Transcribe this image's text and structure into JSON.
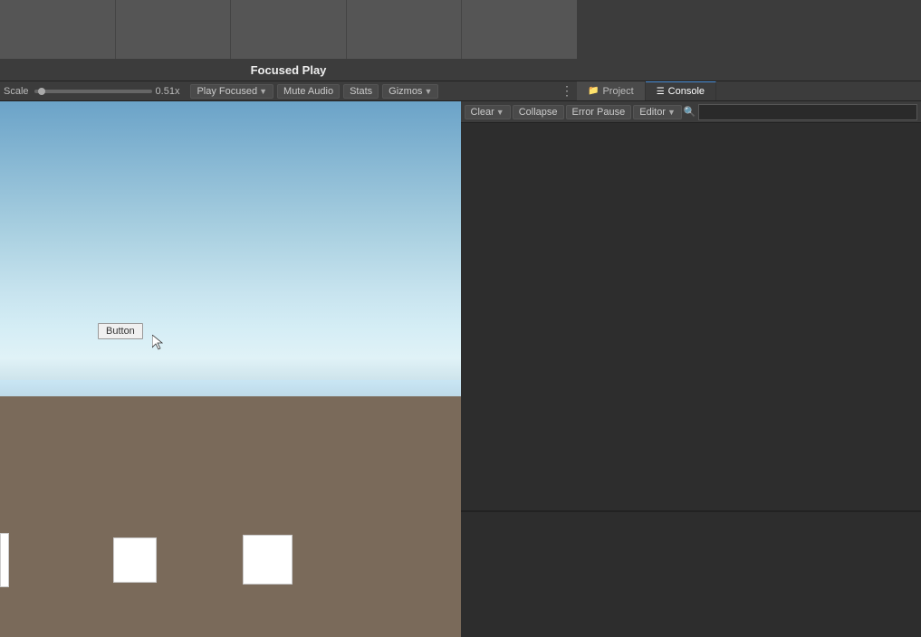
{
  "viewport": {
    "title": "Focused Play",
    "scale_label": "Scale",
    "scale_value": "0.51x",
    "play_focused_label": "Play Focused",
    "mute_audio_label": "Mute Audio",
    "stats_label": "Stats",
    "gizmos_label": "Gizmos"
  },
  "scene_button": {
    "label": "Button"
  },
  "tabs": [
    {
      "id": "project",
      "label": "Project",
      "icon": "📁",
      "active": false
    },
    {
      "id": "console",
      "label": "Console",
      "icon": "☰",
      "active": true
    }
  ],
  "console_toolbar": {
    "clear_label": "Clear",
    "collapse_label": "Collapse",
    "error_pause_label": "Error Pause",
    "editor_label": "Editor",
    "search_placeholder": ""
  },
  "thumbnails": [
    {
      "id": 1
    },
    {
      "id": 2
    },
    {
      "id": 3
    },
    {
      "id": 4
    },
    {
      "id": 5
    }
  ]
}
